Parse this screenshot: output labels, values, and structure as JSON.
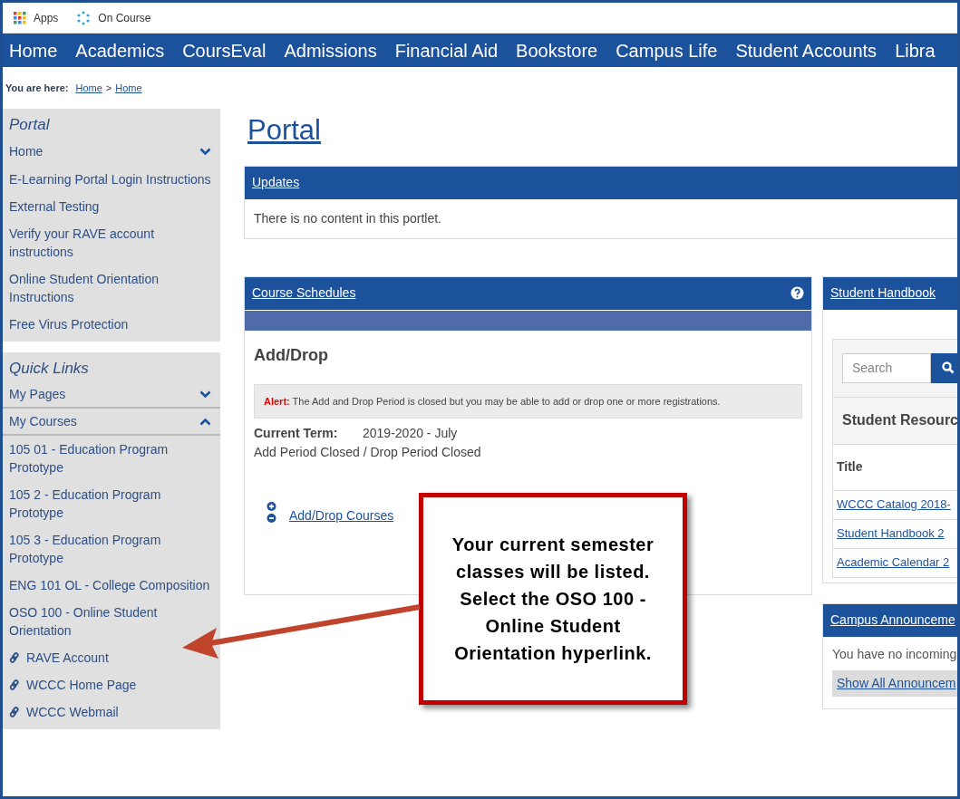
{
  "bookmarks": [
    {
      "label": "Apps",
      "kind": "apps"
    },
    {
      "label": "On Course",
      "kind": "site"
    }
  ],
  "nav": [
    "Home",
    "Academics",
    "CoursEval",
    "Admissions",
    "Financial Aid",
    "Bookstore",
    "Campus Life",
    "Student Accounts",
    "Libra"
  ],
  "breadcrumb": {
    "label": "You are here:",
    "links": [
      "Home",
      "Home"
    ],
    "separator": ">"
  },
  "sidebar": [
    {
      "title": "Portal",
      "items": [
        {
          "label": "Home",
          "kind": "toggle",
          "expanded": false
        },
        {
          "label": "E-Learning Portal Login Instructions",
          "kind": "link"
        },
        {
          "label": "External Testing",
          "kind": "link"
        },
        {
          "label": "Verify your RAVE account instructions",
          "kind": "link"
        },
        {
          "label": "Online Student Orientation Instructions",
          "kind": "link"
        },
        {
          "label": "Free Virus Protection",
          "kind": "link"
        }
      ]
    },
    {
      "title": "Quick Links",
      "items": [
        {
          "label": "My Pages",
          "kind": "toggle",
          "expanded": false
        },
        {
          "label": "My Courses",
          "kind": "toggle",
          "expanded": true,
          "children": [
            {
              "label": "105 01 - Education Program Prototype"
            },
            {
              "label": "105 2 - Education Program Prototype"
            },
            {
              "label": "105 3 - Education Program Prototype"
            },
            {
              "label": "ENG 101 OL - College Composition"
            },
            {
              "label": "OSO 100 - Online Student Orientation"
            }
          ]
        },
        {
          "label": "RAVE Account",
          "kind": "external"
        },
        {
          "label": "WCCC Home Page",
          "kind": "external"
        },
        {
          "label": "WCCC Webmail",
          "kind": "external"
        }
      ]
    }
  ],
  "page_title": "Portal",
  "updates": {
    "title": "Updates",
    "message": "There is no content in this portlet."
  },
  "course_schedules": {
    "title": "Course Schedules",
    "heading": "Add/Drop",
    "alert_label": "Alert:",
    "alert_text": "The Add and Drop Period is closed but you may be able to add or drop one or more registrations.",
    "term_label": "Current Term:",
    "term_value": "2019-2020 - July",
    "period_status": "Add Period Closed / Drop Period Closed",
    "link": "Add/Drop Courses"
  },
  "student_handbook": {
    "title": "Student Handbook",
    "search": {
      "placeholder": "Search"
    },
    "section_title": "Student Resourc",
    "column": "Title",
    "rows": [
      "WCCC Catalog 2018-",
      "Student Handbook 2",
      "Academic Calendar 2"
    ]
  },
  "campus_announcements": {
    "title": "Campus Announceme",
    "message": "You have no incoming",
    "button": "Show All Announcem"
  },
  "callout": {
    "text": "Your current semester classes will be listed. Select the OSO 100 - Online Student Orientation hyperlink."
  }
}
